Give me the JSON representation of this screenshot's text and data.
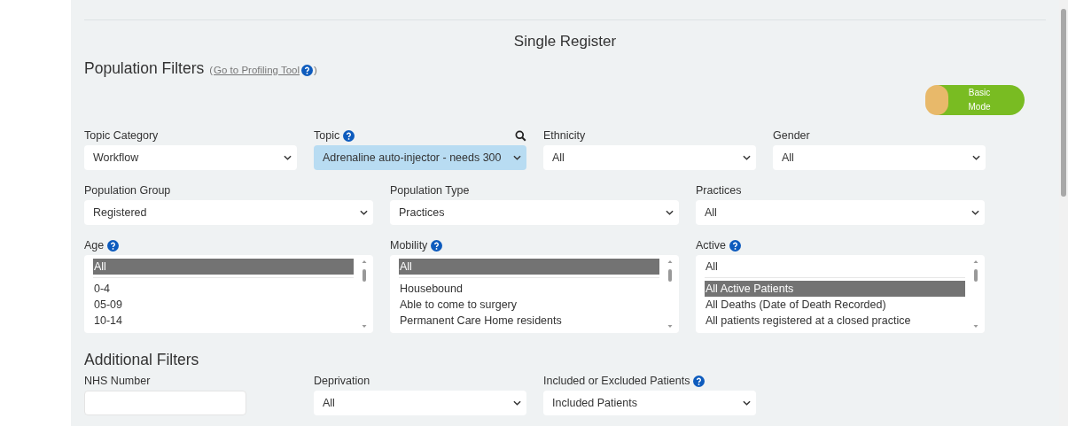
{
  "title": "Single Register",
  "population_filters": {
    "heading": "Population Filters",
    "link_open": "(",
    "link": "Go to Profiling Tool",
    "link_close": ")",
    "mode_toggle": {
      "label_lines": [
        "Basic",
        "Mode"
      ],
      "on": false
    }
  },
  "rows": [
    [
      {
        "kind": "select",
        "label": "Topic Category",
        "help": false,
        "search": false,
        "value": "Workflow",
        "highlighted": false
      },
      {
        "kind": "select",
        "label": "Topic",
        "help": true,
        "search": true,
        "value": "Adrenaline auto-injector - needs 300",
        "highlighted": true
      },
      {
        "kind": "select",
        "label": "Ethnicity",
        "help": false,
        "search": false,
        "value": "All",
        "highlighted": false
      },
      {
        "kind": "select",
        "label": "Gender",
        "help": false,
        "search": false,
        "value": "All",
        "highlighted": false
      }
    ],
    [
      {
        "kind": "select",
        "label": "Population Group",
        "help": false,
        "search": false,
        "value": "Registered",
        "highlighted": false
      },
      {
        "kind": "select",
        "label": "Population Type",
        "help": false,
        "search": false,
        "value": "Practices",
        "highlighted": false
      },
      {
        "kind": "select",
        "label": "Practices",
        "help": false,
        "search": false,
        "value": "All",
        "highlighted": false
      }
    ],
    [
      {
        "kind": "listbox",
        "label": "Age",
        "help": true,
        "search": false,
        "head": {
          "text": "All",
          "selected": true
        },
        "options": [
          {
            "text": "0-4",
            "selected": false
          },
          {
            "text": "05-09",
            "selected": false
          },
          {
            "text": "10-14",
            "selected": false
          }
        ]
      },
      {
        "kind": "listbox",
        "label": "Mobility",
        "help": true,
        "search": false,
        "head": {
          "text": "All",
          "selected": true
        },
        "options": [
          {
            "text": "Housebound",
            "selected": false
          },
          {
            "text": "Able to come to surgery",
            "selected": false
          },
          {
            "text": "Permanent Care Home residents",
            "selected": false
          }
        ]
      },
      {
        "kind": "listbox",
        "label": "Active",
        "help": true,
        "search": false,
        "head": {
          "text": "All",
          "selected": false
        },
        "options": [
          {
            "text": "All Active Patients",
            "selected": true
          },
          {
            "text": "All Deaths (Date of Death Recorded)",
            "selected": false
          },
          {
            "text": "All patients registered at a closed practice",
            "selected": false
          }
        ]
      }
    ]
  ],
  "additional_filters": {
    "heading": "Additional Filters",
    "fields": [
      {
        "kind": "text",
        "label": "NHS Number",
        "help": false,
        "search": false
      },
      {
        "kind": "select",
        "label": "Deprivation",
        "help": false,
        "search": false,
        "value": "All",
        "highlighted": false
      },
      {
        "kind": "select",
        "label": "Included or Excluded Patients",
        "help": true,
        "search": false,
        "value": "Included Patients",
        "highlighted": false
      }
    ]
  }
}
